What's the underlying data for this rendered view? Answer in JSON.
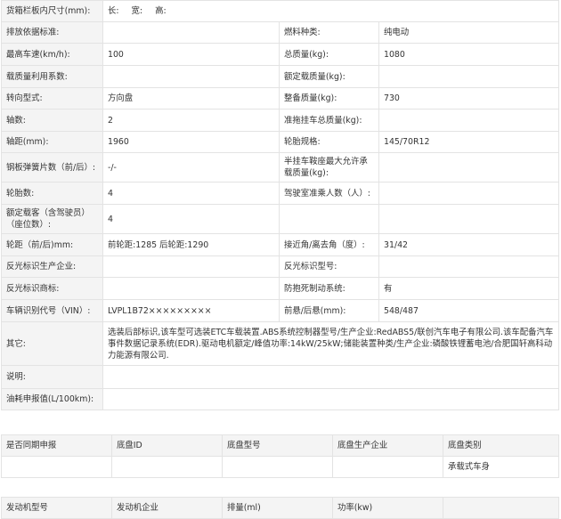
{
  "spec": {
    "dimensions": {
      "label": "货箱栏板内尺寸(mm):",
      "length_label": "长:",
      "width_label": "宽:",
      "height_label": "高:"
    },
    "rows": [
      {
        "l1": "排放依据标准:",
        "v1": "",
        "l2": "燃料种类:",
        "v2": "纯电动"
      },
      {
        "l1": "最高车速(km/h):",
        "v1": "100",
        "l2": "总质量(kg):",
        "v2": "1080"
      },
      {
        "l1": "载质量利用系数:",
        "v1": "",
        "l2": "额定载质量(kg):",
        "v2": ""
      },
      {
        "l1": "转向型式:",
        "v1": "方向盘",
        "l2": "整备质量(kg):",
        "v2": "730"
      },
      {
        "l1": "轴数:",
        "v1": "2",
        "l2": "准拖挂车总质量(kg):",
        "v2": ""
      },
      {
        "l1": "轴距(mm):",
        "v1": "1960",
        "l2": "轮胎规格:",
        "v2": "145/70R12"
      },
      {
        "l1": "钢板弹簧片数（前/后）:",
        "v1": "-/-",
        "l2": "半挂车鞍座最大允许承载质量(kg):",
        "v2": ""
      },
      {
        "l1": "轮胎数:",
        "v1": "4",
        "l2": "驾驶室准乘人数（人）:",
        "v2": ""
      },
      {
        "l1": "额定载客（含驾驶员）（座位数）:",
        "v1": "4",
        "l2": "",
        "v2": ""
      },
      {
        "l1": "轮距（前/后)mm:",
        "v1": "前轮距:1285 后轮距:1290",
        "l2": "接近角/离去角（度）:",
        "v2": "31/42"
      },
      {
        "l1": "反光标识生产企业:",
        "v1": "",
        "l2": "反光标识型号:",
        "v2": ""
      },
      {
        "l1": "反光标识商标:",
        "v1": "",
        "l2": "防抱死制动系统:",
        "v2": "有"
      },
      {
        "l1": "车辆识别代号（VIN）:",
        "v1": "LVPL1B72×××××××××",
        "l2": "前悬/后悬(mm):",
        "v2": "548/487"
      }
    ],
    "other": {
      "label": "其它:",
      "value": "选装后部标识,该车型可选装ETC车载装置.ABS系统控制器型号/生产企业:RedABS5/联创汽车电子有限公司.该车配备汽车事件数据记录系统(EDR).驱动电机额定/峰值功率:14kW/25kW;储能装置种类/生产企业:磷酸铁锂蓄电池/合肥国轩高科动力能源有限公司."
    },
    "note": {
      "label": "说明:",
      "value": ""
    },
    "fuel": {
      "label": "油耗申报值(L/100km):",
      "value": ""
    }
  },
  "chassis": {
    "headers": [
      "是否同期申报",
      "底盘ID",
      "底盘型号",
      "底盘生产企业",
      "底盘类别"
    ],
    "row": [
      "",
      "",
      "",
      "",
      "承载式车身"
    ]
  },
  "engine": {
    "headers": [
      "发动机型号",
      "发动机企业",
      "排量(ml)",
      "功率(kw)",
      ""
    ]
  }
}
